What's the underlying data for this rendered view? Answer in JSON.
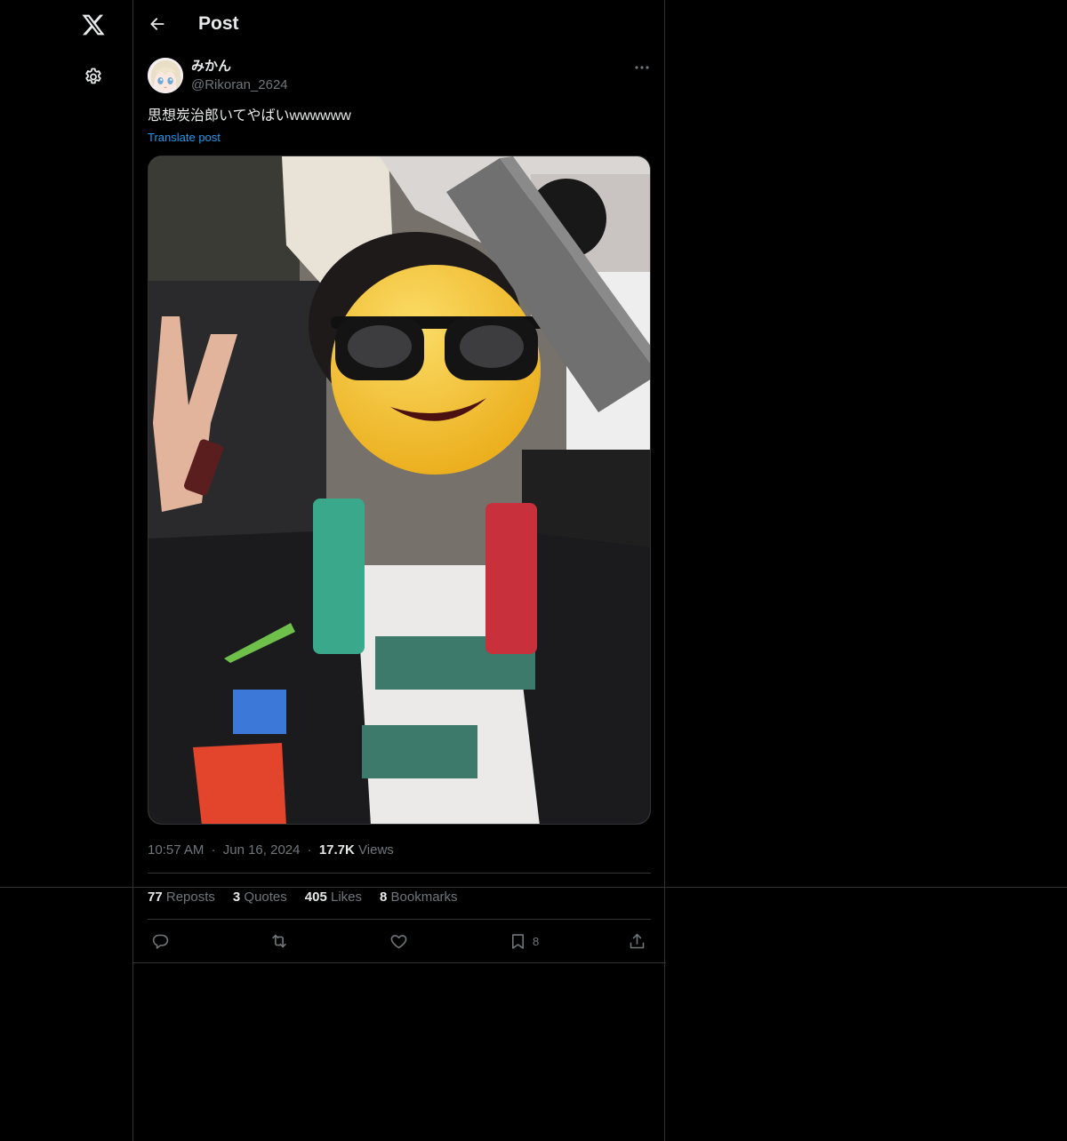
{
  "header": {
    "title": "Post"
  },
  "author": {
    "name": "みかん",
    "handle": "@Rikoran_2624"
  },
  "post": {
    "text": "思想炭治郎いてやばいwwwwww",
    "translate_label": "Translate post",
    "time": "10:57 AM",
    "date": "Jun 16, 2024",
    "views_count": "17.7K",
    "views_label": "Views",
    "separator": "·"
  },
  "stats": {
    "reposts_count": "77",
    "reposts_label": "Reposts",
    "quotes_count": "3",
    "quotes_label": "Quotes",
    "likes_count": "405",
    "likes_label": "Likes",
    "bookmarks_count": "8",
    "bookmarks_label": "Bookmarks"
  },
  "actions": {
    "bookmark_count": "8"
  },
  "icons": {
    "nav": [
      "x-logo-icon",
      "gear-icon"
    ],
    "header": [
      "back-arrow-icon"
    ],
    "post": [
      "more-options-icon"
    ],
    "actions": [
      "reply-icon",
      "repost-icon",
      "like-icon",
      "bookmark-icon",
      "share-icon"
    ]
  },
  "colors": {
    "background": "#000000",
    "text": "#e7e9ea",
    "muted": "#71767b",
    "link": "#1d9bf0",
    "border": "#2f3336"
  }
}
